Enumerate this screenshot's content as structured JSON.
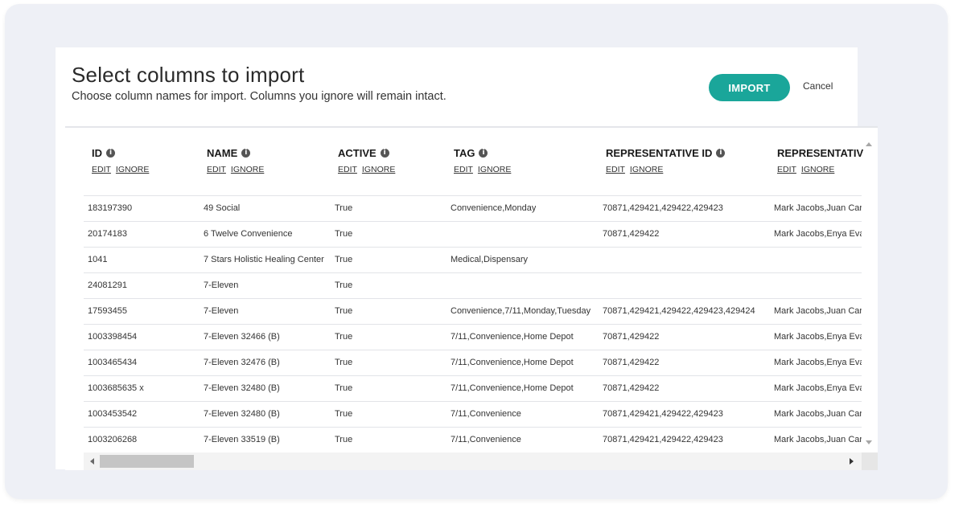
{
  "dialog": {
    "title": "Select columns to import",
    "subtitle": "Choose column names for import. Columns you ignore will remain intact.",
    "import_label": "IMPORT",
    "cancel_label": "Cancel"
  },
  "colors": {
    "accent": "#1aa69a",
    "background": "#eef0f6"
  },
  "columns": [
    {
      "label": "ID",
      "edit": "EDIT",
      "ignore": "IGNORE"
    },
    {
      "label": "NAME",
      "edit": "EDIT",
      "ignore": "IGNORE"
    },
    {
      "label": "ACTIVE",
      "edit": "EDIT",
      "ignore": "IGNORE"
    },
    {
      "label": "TAG",
      "edit": "EDIT",
      "ignore": "IGNORE"
    },
    {
      "label": "REPRESENTATIVE ID",
      "edit": "EDIT",
      "ignore": "IGNORE"
    },
    {
      "label": "REPRESENTATIV",
      "edit": "EDIT",
      "ignore": "IGNORE"
    }
  ],
  "rows": [
    [
      "183197390",
      "49 Social",
      "True",
      "Convenience,Monday",
      "70871,429421,429422,429423",
      "Mark Jacobs,Juan Car"
    ],
    [
      "20174183",
      "6 Twelve Convenience",
      "True",
      "",
      "70871,429422",
      "Mark Jacobs,Enya Eva"
    ],
    [
      "1041",
      "7 Stars Holistic Healing Center",
      "True",
      "Medical,Dispensary",
      "",
      ""
    ],
    [
      "24081291",
      "7-Eleven",
      "True",
      "",
      "",
      ""
    ],
    [
      "17593455",
      "7-Eleven",
      "True",
      "Convenience,7/11,Monday,Tuesday",
      "70871,429421,429422,429423,429424",
      "Mark Jacobs,Juan Car"
    ],
    [
      "1003398454",
      "7-Eleven 32466 (B)",
      "True",
      "7/11,Convenience,Home Depot",
      "70871,429422",
      "Mark Jacobs,Enya Eva"
    ],
    [
      "1003465434",
      "7-Eleven 32476 (B)",
      "True",
      "7/11,Convenience,Home Depot",
      "70871,429422",
      "Mark Jacobs,Enya Eva"
    ],
    [
      "1003685635 x",
      "7-Eleven 32480 (B)",
      "True",
      "7/11,Convenience,Home Depot",
      "70871,429422",
      "Mark Jacobs,Enya Eva"
    ],
    [
      "1003453542",
      "7-Eleven 32480 (B)",
      "True",
      "7/11,Convenience",
      "70871,429421,429422,429423",
      "Mark Jacobs,Juan Car"
    ],
    [
      "1003206268",
      "7-Eleven 33519 (B)",
      "True",
      "7/11,Convenience",
      "70871,429421,429422,429423",
      "Mark Jacobs,Juan Car"
    ]
  ]
}
